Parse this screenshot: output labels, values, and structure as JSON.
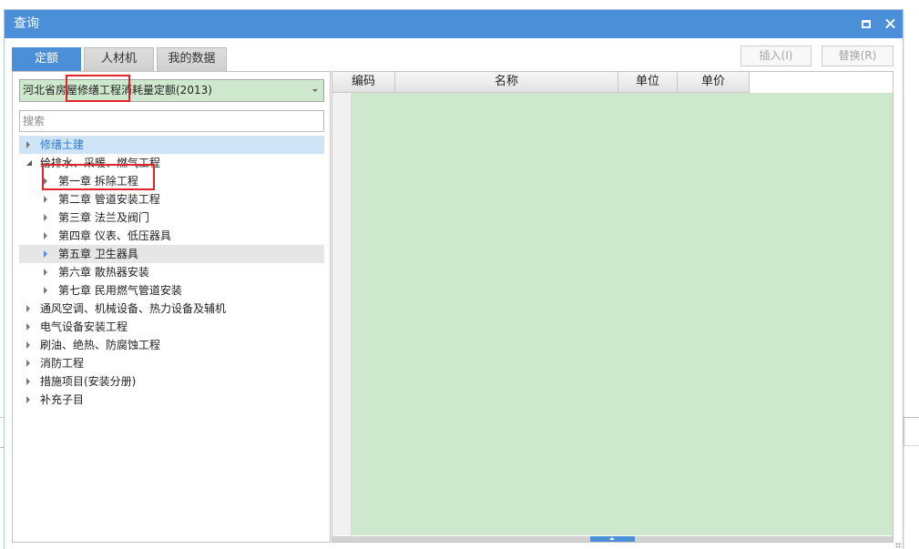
{
  "window": {
    "title": "查询",
    "maximize_icon": "maximize-icon",
    "close_icon": "close-icon"
  },
  "tabs": [
    {
      "label": "定额",
      "active": true
    },
    {
      "label": "人材机",
      "active": false
    },
    {
      "label": "我的数据",
      "active": false
    }
  ],
  "actions": {
    "insert_label": "插入(I)",
    "replace_label": "替换(R)",
    "enabled": false
  },
  "library": {
    "selected": "河北省房屋修缮工程消耗量定额(2013)",
    "icon": "chevron-down-icon"
  },
  "search": {
    "placeholder": "搜索"
  },
  "tree": {
    "collapsed_icon": "caret-right-icon",
    "expanded_icon": "caret-down-icon",
    "items": [
      {
        "label": "修缮土建",
        "level": 0,
        "expanded": false,
        "selected": true
      },
      {
        "label": "给排水、采暖、燃气工程",
        "level": 0,
        "expanded": true
      },
      {
        "label": "第一章 拆除工程",
        "level": 1,
        "expanded": false
      },
      {
        "label": "第二章 管道安装工程",
        "level": 1,
        "expanded": false
      },
      {
        "label": "第三章 法兰及阀门",
        "level": 1,
        "expanded": false
      },
      {
        "label": "第四章 仪表、低压器具",
        "level": 1,
        "expanded": false
      },
      {
        "label": "第五章 卫生器具",
        "level": 1,
        "expanded": false,
        "hover": true
      },
      {
        "label": "第六章 散热器安装",
        "level": 1,
        "expanded": false
      },
      {
        "label": "第七章 民用燃气管道安装",
        "level": 1,
        "expanded": false
      },
      {
        "label": "通风空调、机械设备、热力设备及辅机",
        "level": 0,
        "expanded": false
      },
      {
        "label": "电气设备安装工程",
        "level": 0,
        "expanded": false
      },
      {
        "label": "刷油、绝热、防腐蚀工程",
        "level": 0,
        "expanded": false
      },
      {
        "label": "消防工程",
        "level": 0,
        "expanded": false
      },
      {
        "label": "措施项目(安装分册)",
        "level": 0,
        "expanded": false
      },
      {
        "label": "补充子目",
        "level": 0,
        "expanded": false
      }
    ]
  },
  "grid": {
    "columns": [
      {
        "label": "编码"
      },
      {
        "label": "名称"
      },
      {
        "label": "单位"
      },
      {
        "label": "单价"
      }
    ],
    "rows": []
  },
  "colors": {
    "title_bar": "#4b8fd8",
    "active_tab": "#4b8fd8",
    "accent": "#4b8fd8",
    "selected_row_bg": "#cfe4f7",
    "selected_row_text": "#2b79d0",
    "hover_row_bg": "#e6e6e6",
    "grid_body": "#cde8cd",
    "dropdown_bg": "#cde8cd",
    "annotation": "#e0242a"
  }
}
